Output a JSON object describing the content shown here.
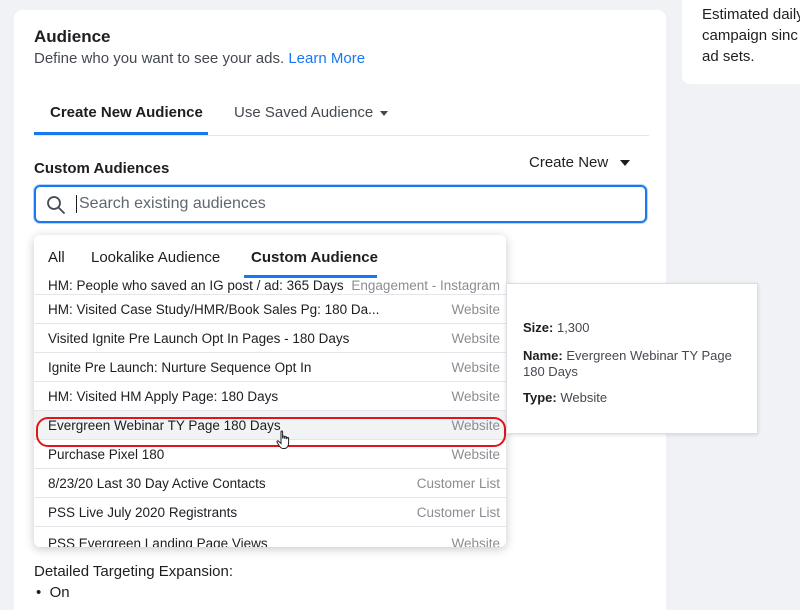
{
  "side": {
    "lines": [
      "Estimated daily",
      "campaign sinc",
      "ad sets."
    ]
  },
  "audience": {
    "title": "Audience",
    "subtitle": "Define who you want to see your ads.",
    "learn_more": "Learn More",
    "tabs": [
      {
        "label": "Create New Audience",
        "active": true
      },
      {
        "label": "Use Saved Audience",
        "active": false
      }
    ]
  },
  "custom_audiences": {
    "label": "Custom Audiences",
    "create_new": "Create New",
    "search_placeholder": "Search existing audiences"
  },
  "dropdown": {
    "tabs": [
      "All",
      "Lookalike Audience",
      "Custom Audience"
    ],
    "active_tab": "Custom Audience",
    "rows": [
      {
        "name": "HM: People who saved an IG post / ad: 365 Days",
        "type": "Engagement - Instagram"
      },
      {
        "name": "HM: Visited Case Study/HMR/Book Sales Pg: 180 Da...",
        "type": "Website"
      },
      {
        "name": "Visited Ignite Pre Launch Opt In Pages - 180 Days",
        "type": "Website"
      },
      {
        "name": "Ignite Pre Launch: Nurture Sequence Opt In",
        "type": "Website"
      },
      {
        "name": "HM: Visited HM Apply Page: 180 Days",
        "type": "Website"
      },
      {
        "name": "Evergreen Webinar TY Page 180 Days",
        "type": "Website"
      },
      {
        "name": "Purchase Pixel 180",
        "type": "Website"
      },
      {
        "name": "8/23/20 Last 30 Day Active Contacts",
        "type": "Customer List"
      },
      {
        "name": "PSS Live July 2020 Registrants",
        "type": "Customer List"
      },
      {
        "name": "PSS Evergreen Landing Page Views",
        "type": "Website"
      }
    ],
    "highlighted_index": 5
  },
  "info_panel": {
    "size_label": "Size:",
    "size_value": "1,300",
    "name_label": "Name:",
    "name_value": "Evergreen Webinar TY Page 180 Days",
    "type_label": "Type:",
    "type_value": "Website"
  },
  "detailed_targeting": {
    "label": "Detailed Targeting Expansion:",
    "value": "On",
    "bullet": "•"
  },
  "colors": {
    "accent": "#1877f2",
    "highlight_outline": "#e0151b"
  }
}
